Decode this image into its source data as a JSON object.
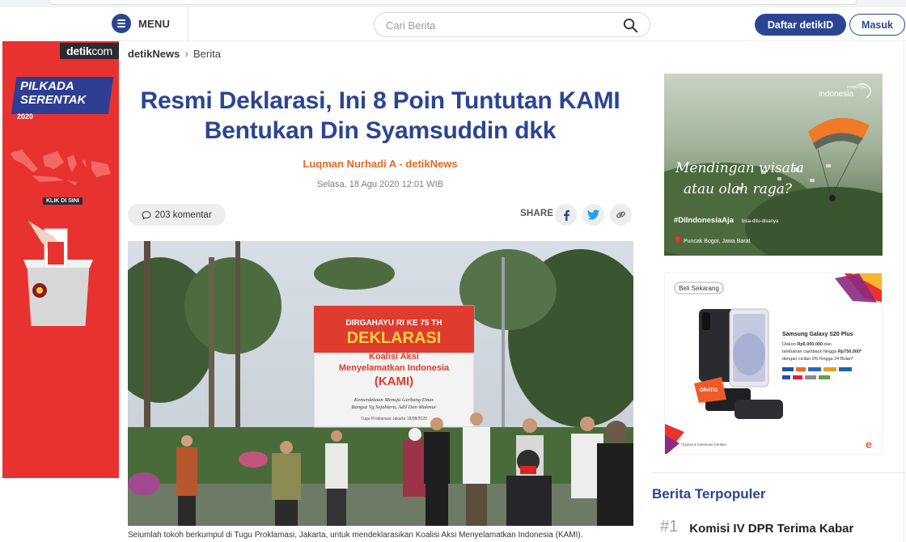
{
  "header": {
    "menu_label": "MENU",
    "search_placeholder": "Cari Berita",
    "register_label": "Daftar detikID",
    "login_label": "Masuk"
  },
  "left_ad": {
    "brand": "detik",
    "brand_suffix": "com",
    "line1": "PILKADA",
    "line2": "SERENTAK",
    "year": "2020",
    "cta": "KLIK DI SINI"
  },
  "breadcrumb": {
    "section": "detikNews",
    "subsection": "Berita"
  },
  "article": {
    "title_line1": "Resmi Deklarasi, Ini 8 Poin Tuntutan KAMI",
    "title_line2": "Bentukan Din Syamsuddin dkk",
    "author": "Luqman Nurhadi A - detikNews",
    "date": "Selasa, 18 Agu 2020 12:01 WIB",
    "comments": "203 komentar",
    "share_label": "SHARE",
    "caption": "Seiumlah tokoh berkumpul di Tugu Proklamasi, Jakarta, untuk mendeklarasikan Koalisi Aksi Menyelamatkan Indonesia (KAMI)."
  },
  "photo_banner": {
    "line1": "DIRGAHAYU RI KE 75 TH",
    "line2": "DEKLARASI",
    "line3": "Koalisi Aksi",
    "line4": "Menyelamatkan Indonesia",
    "line5": "(KAMI)",
    "line6": "Kemerdekaan Menuju Gerbang Emas",
    "line7": "Bangsa Yg Sejahtera, Adil Dan Makmur",
    "line8": "Tugu Proklamasi Jakarta 18/08/2020"
  },
  "ad_wonderful": {
    "brand_top": "wonderful",
    "brand": "indonesia",
    "slogan_line1": "Mendingan wisata",
    "slogan_line2": "atau olah raga?",
    "hashtag": "#DiIndonesiaAja",
    "hashtag_sub": "bisa-ditu-disanya",
    "location": "Puncak Bogor, Jawa Barat"
  },
  "ad_samsung": {
    "cta": "Beli Sekarang",
    "product": "Samsung Galaxy S20 Plus",
    "line1_prefix": "Diskon ",
    "line1_amount": "Rp5.000.000",
    "line1_suffix": " dan",
    "line2_prefix": "tambahan cashback hingga ",
    "line2_amount": "Rp750.000*",
    "line3": "dengan cicilan 0% hingga 24 Bulan*",
    "gift": "GRATIS",
    "terms": "*Syarat & ketentuan berlaku"
  },
  "popular": {
    "heading": "Berita Terpopuler",
    "items": [
      {
        "rank": "#1",
        "title": "Komisi IV DPR Terima Kabar"
      }
    ]
  },
  "colors": {
    "brand_blue": "#2b4592",
    "author_orange": "#e36a26",
    "ad_red": "#e8322f"
  }
}
